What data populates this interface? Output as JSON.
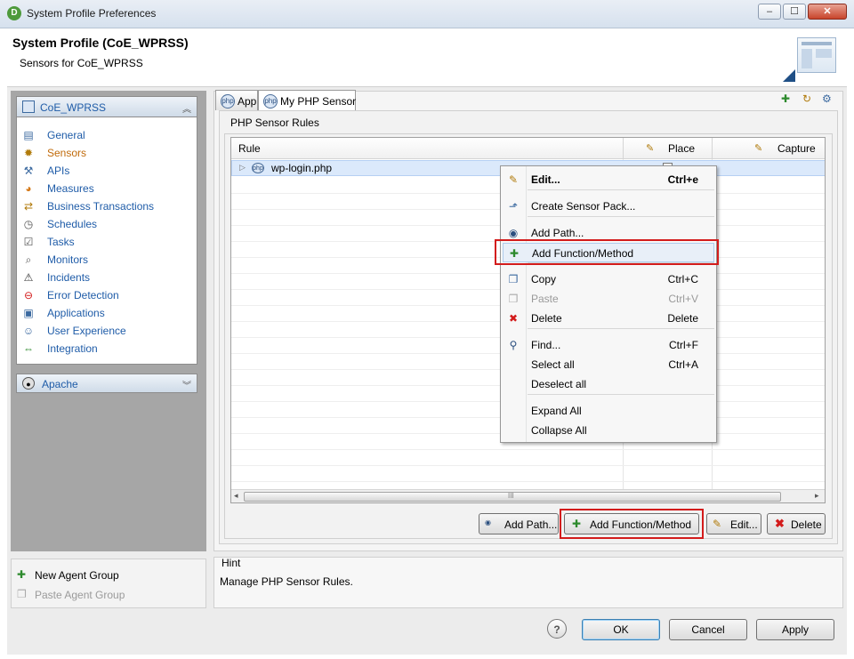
{
  "window": {
    "title": "System Profile Preferences",
    "minimize": "‒",
    "maximize": "☐",
    "close": "✕"
  },
  "header": {
    "title": "System Profile (CoE_WPRSS)",
    "subtitle": "Sensors for CoE_WPRSS"
  },
  "profile_panel": {
    "title": "CoE_WPRSS",
    "items": [
      {
        "label": "General",
        "icon": "general-icon"
      },
      {
        "label": "Sensors",
        "icon": "sensors-icon"
      },
      {
        "label": "APIs",
        "icon": "apis-icon"
      },
      {
        "label": "Measures",
        "icon": "measures-icon"
      },
      {
        "label": "Business Transactions",
        "icon": "business-transactions-icon"
      },
      {
        "label": "Schedules",
        "icon": "clock-icon"
      },
      {
        "label": "Tasks",
        "icon": "tasks-icon"
      },
      {
        "label": "Monitors",
        "icon": "magnifier-icon"
      },
      {
        "label": "Incidents",
        "icon": "warning-icon"
      },
      {
        "label": "Error Detection",
        "icon": "error-icon"
      },
      {
        "label": "Applications",
        "icon": "applications-icon"
      },
      {
        "label": "User Experience",
        "icon": "user-experience-icon"
      },
      {
        "label": "Integration",
        "icon": "integration-icon"
      }
    ],
    "active": "Sensors"
  },
  "apache_panel": {
    "title": "Apache"
  },
  "agent_group": {
    "new": "New Agent Group",
    "paste": "Paste Agent Group"
  },
  "tabs": [
    {
      "label": "App"
    },
    {
      "label": "My PHP Sensor"
    }
  ],
  "rules_group": {
    "label": "PHP Sensor Rules"
  },
  "table": {
    "columns": [
      {
        "label": "Rule"
      },
      {
        "label": "Place"
      },
      {
        "label": "Capture"
      }
    ],
    "rows": [
      {
        "rule": "wp-login.php"
      }
    ],
    "scroll_mid": "III",
    "left_arrow": "◂",
    "right_arrow": "▸"
  },
  "context_menu": {
    "items": [
      {
        "label": "Edit...",
        "shortcut": "Ctrl+e"
      },
      {
        "label": "Create Sensor Pack...",
        "shortcut": ""
      },
      {
        "label": "Add Path...",
        "shortcut": ""
      },
      {
        "label": "Add Function/Method",
        "shortcut": ""
      },
      {
        "label": "Copy",
        "shortcut": "Ctrl+C"
      },
      {
        "label": "Paste",
        "shortcut": "Ctrl+V"
      },
      {
        "label": "Delete",
        "shortcut": "Delete"
      },
      {
        "label": "Find...",
        "shortcut": "Ctrl+F"
      },
      {
        "label": "Select all",
        "shortcut": "Ctrl+A"
      },
      {
        "label": "Deselect all",
        "shortcut": ""
      },
      {
        "label": "Expand All",
        "shortcut": ""
      },
      {
        "label": "Collapse All",
        "shortcut": ""
      }
    ]
  },
  "actions": {
    "add_path": "Add Path...",
    "add_function": "Add Function/Method",
    "edit": "Edit...",
    "delete": "Delete"
  },
  "hint": {
    "title": "Hint",
    "text": "Manage PHP Sensor Rules."
  },
  "footer": {
    "help": "?",
    "ok": "OK",
    "cancel": "Cancel",
    "apply": "Apply"
  },
  "colors": {
    "highlight_border": "#d31c1c",
    "link_blue": "#1f5ca8",
    "active_orange": "#c06a0a"
  }
}
